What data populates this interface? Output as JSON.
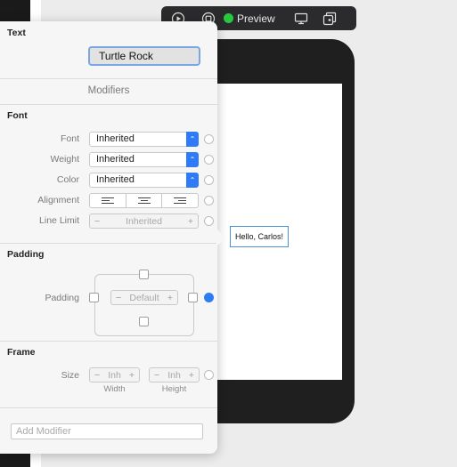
{
  "toolbar": {
    "play_icon": "play-icon",
    "inspect_icon": "inspect-icon",
    "preview_label": "Preview",
    "preview_status_color": "#27c93f",
    "device_icon": "device-icon",
    "duplicate_icon": "duplicate-icon"
  },
  "canvas": {
    "hello_label": "Hello, Carlos!"
  },
  "inspector": {
    "text_section": {
      "title": "Text",
      "value": "Turtle Rock"
    },
    "modifiers_header": "Modifiers",
    "font_section": {
      "title": "Font",
      "font_label": "Font",
      "font_value": "Inherited",
      "weight_label": "Weight",
      "weight_value": "Inherited",
      "color_label": "Color",
      "color_value": "Inherited",
      "alignment_label": "Alignment",
      "alignment_options": [
        "left",
        "center",
        "right"
      ],
      "line_limit_label": "Line Limit",
      "line_limit_value": "Inherited",
      "minus": "−",
      "plus": "+"
    },
    "padding_section": {
      "title": "Padding",
      "padding_label": "Padding",
      "padding_value": "Default",
      "minus": "−",
      "plus": "+"
    },
    "frame_section": {
      "title": "Frame",
      "size_label": "Size",
      "width_value": "Inh",
      "height_value": "Inh",
      "width_caption": "Width",
      "height_caption": "Height",
      "minus": "−",
      "plus": "+"
    },
    "add_modifier_placeholder": "Add Modifier"
  },
  "colors": {
    "accent": "#2f7bf5",
    "toolbar_bg": "#2b2b2d",
    "device_bg": "#1f1f1f"
  }
}
